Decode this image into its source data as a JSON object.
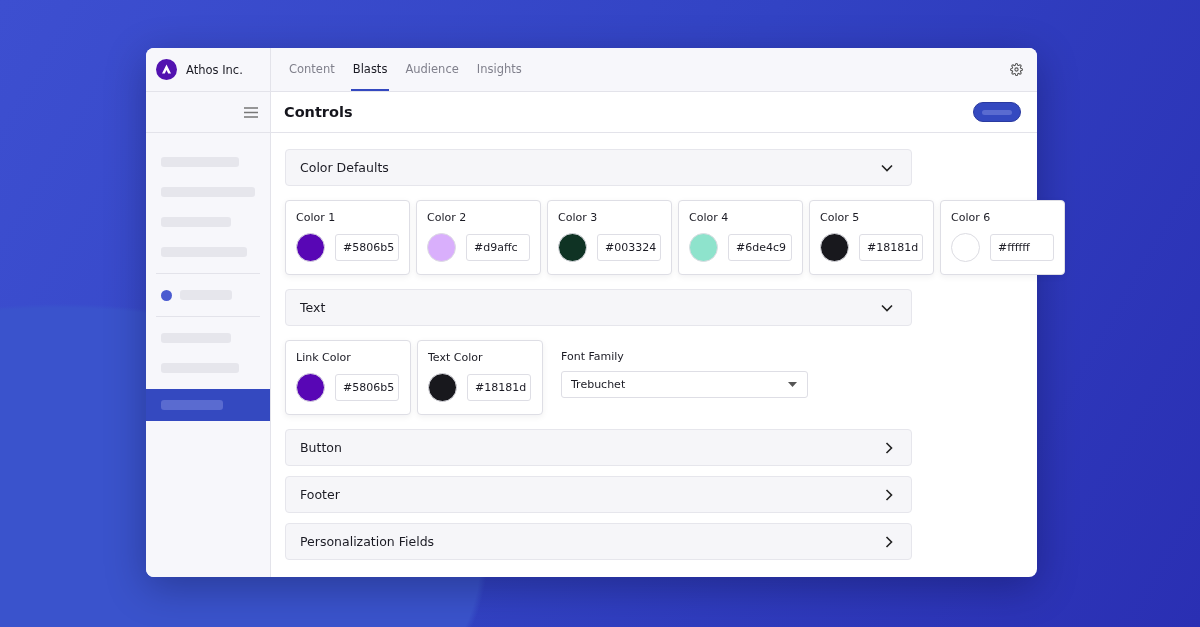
{
  "brand": {
    "name": "Athos Inc."
  },
  "tabs": [
    {
      "label": "Content",
      "selected": false
    },
    {
      "label": "Blasts",
      "selected": true
    },
    {
      "label": "Audience",
      "selected": false
    },
    {
      "label": "Insights",
      "selected": false
    }
  ],
  "sidebar": {
    "groups": [
      [
        {
          "kind": "placeholder",
          "selected": false
        },
        {
          "kind": "placeholder",
          "selected": false
        },
        {
          "kind": "placeholder",
          "selected": false
        },
        {
          "kind": "placeholder",
          "selected": false
        }
      ],
      [
        {
          "kind": "status",
          "selected": false,
          "color": "#4a5bd0"
        }
      ],
      [
        {
          "kind": "placeholder",
          "selected": false
        },
        {
          "kind": "placeholder",
          "selected": false
        },
        {
          "kind": "placeholder",
          "selected": true
        }
      ]
    ]
  },
  "page": {
    "title": "Controls"
  },
  "sections": [
    {
      "title": "Color Defaults",
      "expanded": true,
      "fields": [
        {
          "kind": "color",
          "label": "Color 1",
          "value": "#5806b5",
          "color": "#5806b5"
        },
        {
          "kind": "color",
          "label": "Color 2",
          "value": "#d9affc",
          "color": "#d9affc"
        },
        {
          "kind": "color",
          "label": "Color 3",
          "value": "#003324",
          "color": "#0f3324"
        },
        {
          "kind": "color",
          "label": "Color 4",
          "value": "#6de4c9",
          "color": "#8ee3cc"
        },
        {
          "kind": "color",
          "label": "Color 5",
          "value": "#18181d",
          "color": "#18181d"
        },
        {
          "kind": "color",
          "label": "Color 6",
          "value": "#ffffff",
          "color": "#ffffff"
        }
      ]
    },
    {
      "title": "Text",
      "expanded": true,
      "fields": [
        {
          "kind": "color",
          "label": "Link Color",
          "value": "#5806b5",
          "color": "#5806b5"
        },
        {
          "kind": "color",
          "label": "Text Color",
          "value": "#18181d",
          "color": "#18181d"
        },
        {
          "kind": "select",
          "label": "Font Family",
          "value": "Trebuchet"
        }
      ]
    },
    {
      "title": "Button",
      "expanded": false
    },
    {
      "title": "Footer",
      "expanded": false
    },
    {
      "title": "Personalization Fields",
      "expanded": false
    }
  ]
}
